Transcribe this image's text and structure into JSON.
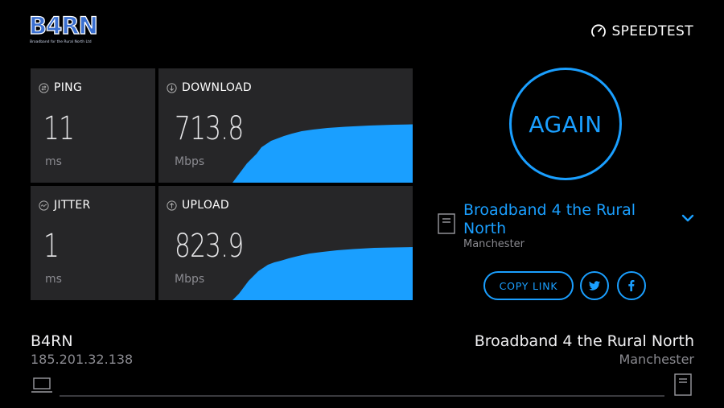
{
  "logo": {
    "name": "B4RN",
    "tagline": "Broadband for the Rural North Ltd"
  },
  "brand": {
    "name": "SPEEDTEST",
    "icon": "gauge-icon",
    "tm": "®"
  },
  "metrics": {
    "ping": {
      "label": "PING",
      "value": "11",
      "unit": "ms",
      "icon": "ping-icon"
    },
    "download": {
      "label": "DOWNLOAD",
      "value": "713.8",
      "unit": "Mbps",
      "icon": "download-arrow-icon"
    },
    "jitter": {
      "label": "JITTER",
      "value": "1",
      "unit": "ms",
      "icon": "jitter-wave-icon"
    },
    "upload": {
      "label": "UPLOAD",
      "value": "823.9",
      "unit": "Mbps",
      "icon": "upload-arrow-icon"
    }
  },
  "again_button": {
    "label": "AGAIN"
  },
  "server": {
    "name": "Broadband 4 the Rural North",
    "location": "Manchester",
    "icon": "server-icon"
  },
  "share": {
    "copy_link_label": "COPY LINK",
    "twitter_icon": "twitter-icon",
    "facebook_icon": "facebook-icon"
  },
  "footer": {
    "isp_name": "B4RN",
    "isp_ip": "185.201.32.138",
    "host_name": "Broadband 4 the Rural North",
    "host_location": "Manchester"
  },
  "colors": {
    "accent": "#1a9fff",
    "tile_bg": "#262628",
    "background": "#000000",
    "muted_text": "#8a8a90"
  }
}
